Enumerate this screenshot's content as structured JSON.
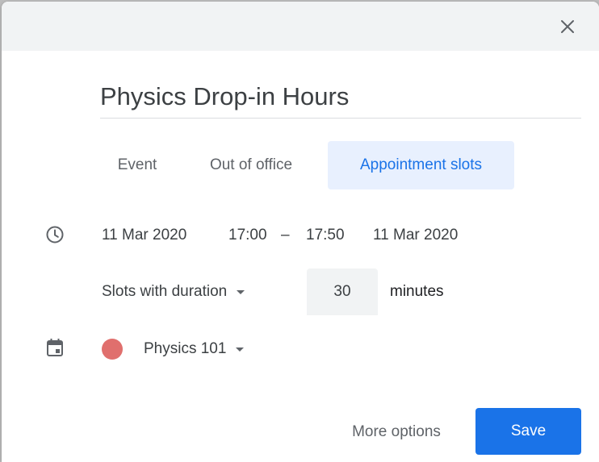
{
  "dialog": {
    "close_icon": "close-icon",
    "title": "Physics Drop-in Hours"
  },
  "tabs": [
    {
      "label": "Event",
      "selected": false
    },
    {
      "label": "Out of office",
      "selected": false
    },
    {
      "label": "Appointment slots",
      "selected": true
    }
  ],
  "time": {
    "icon": "clock-icon",
    "start_date": "11 Mar 2020",
    "start_time": "17:00",
    "separator": "–",
    "end_time": "17:50",
    "end_date": "11 Mar 2020"
  },
  "slots": {
    "mode": "Slots with duration",
    "duration": "30",
    "unit": "minutes"
  },
  "calendar": {
    "icon": "calendar-icon",
    "color": "#e06f6d",
    "name": "Physics 101"
  },
  "footer": {
    "more_options_label": "More options",
    "save_label": "Save"
  },
  "colors": {
    "accent": "#1a73e8",
    "selected_tab_bg": "#e8f0fe",
    "header_bg": "#f1f3f4"
  }
}
